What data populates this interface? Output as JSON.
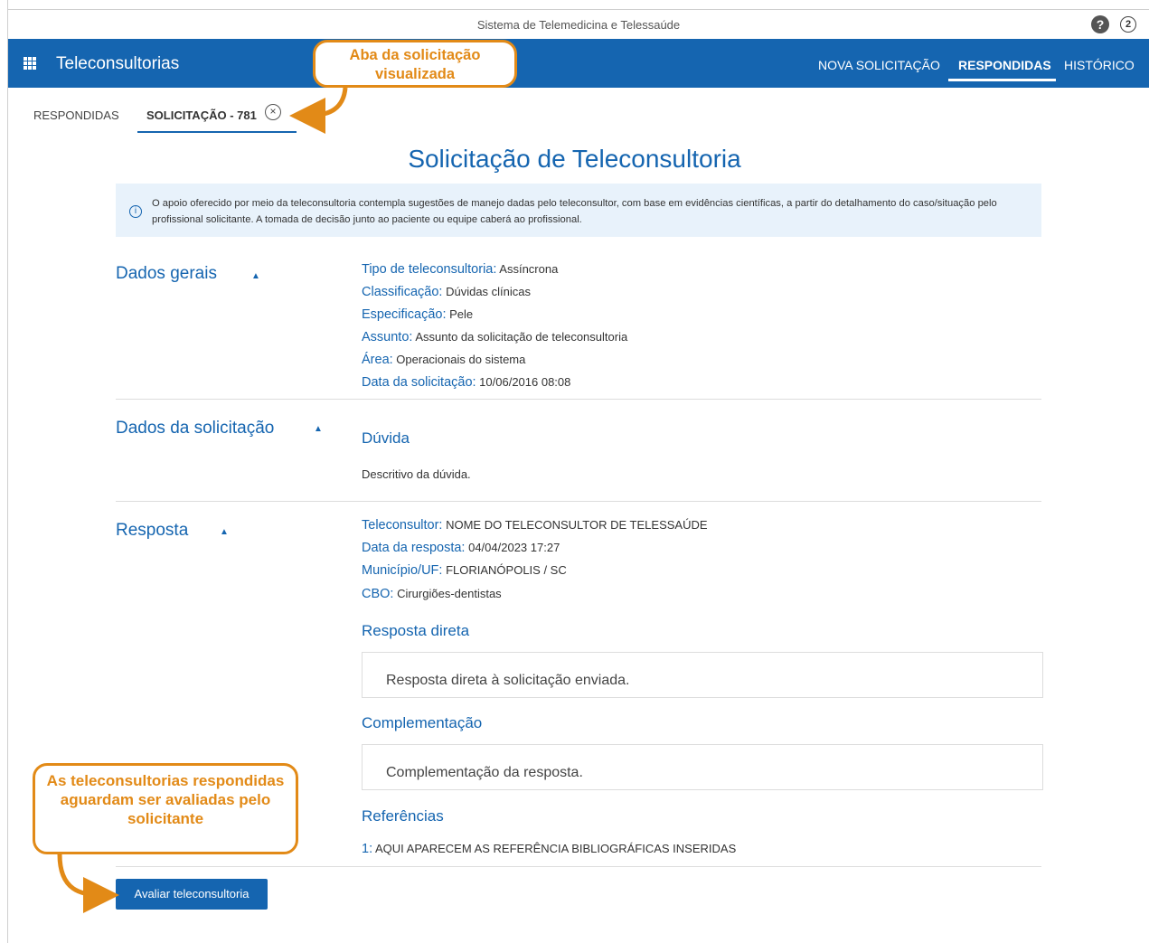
{
  "window": {
    "title": "Sistema de Telemedicina e Telessaúde",
    "help_icon": "question-circle-icon",
    "help_glyph": "?",
    "counter": "2"
  },
  "appbar": {
    "icon": "apps-grid-icon",
    "title": "Teleconsultorias",
    "color": "#1565b0",
    "nav": [
      "NOVA SOLICITAÇÃO",
      "RESPONDIDAS",
      "HISTÓRICO"
    ],
    "active": "RESPONDIDAS"
  },
  "tabs": {
    "items": [
      "RESPONDIDAS",
      "SOLICITAÇÃO - 781"
    ],
    "active": "SOLICITAÇÃO - 781",
    "close_glyph": "×"
  },
  "page": {
    "title": "Solicitação de Teleconsultoria",
    "info_glyph": "i",
    "info": "O apoio oferecido por meio da teleconsultoria contempla sugestões de manejo dadas pelo teleconsultor, com base em evidências científicas, a partir do detalhamento do caso/situação pelo profissional solicitante. A tomada de decisão junto ao paciente ou equipe caberá ao profissional."
  },
  "dados_gerais": {
    "heading": "Dados gerais",
    "fields": [
      {
        "label": "Tipo de teleconsultoria:",
        "value": "Assíncrona"
      },
      {
        "label": "Classificação:",
        "value": "Dúvidas clínicas"
      },
      {
        "label": "Especificação:",
        "value": "Pele"
      },
      {
        "label": "Assunto:",
        "value": "Assunto da solicitação de teleconsultoria"
      },
      {
        "label": "Área:",
        "value": "Operacionais do sistema"
      },
      {
        "label": "Data da solicitação:",
        "value": "10/06/2016 08:08"
      }
    ]
  },
  "dados_solicitacao": {
    "heading": "Dados da solicitação",
    "duvida_title": "Dúvida",
    "duvida_text": "Descritivo da dúvida."
  },
  "resposta": {
    "heading": "Resposta",
    "fields": [
      {
        "label": "Teleconsultor:",
        "value": "NOME DO TELECONSULTOR DE TELESSAÚDE"
      },
      {
        "label": "Data da resposta:",
        "value": "04/04/2023 17:27"
      },
      {
        "label": "Município/UF:",
        "value": "FLORIANÓPOLIS / SC"
      },
      {
        "label": "CBO:",
        "value": "Cirurgiões-dentistas"
      }
    ],
    "direta_title": "Resposta direta",
    "direta_text": "Resposta direta à solicitação enviada.",
    "complementacao_title": "Complementação",
    "complementacao_text": "Complementação da resposta.",
    "referencias_title": "Referências",
    "referencia_num": "1:",
    "referencia_text": "AQUI APARECEM AS REFERÊNCIA BIBLIOGRÁFICAS INSERIDAS"
  },
  "actions": {
    "avaliar": "Avaliar teleconsultoria"
  },
  "callouts": {
    "tab": "Aba da solicitação visualizada",
    "avaliar": "As teleconsultorias respondidas aguardam ser avaliadas pelo solicitante",
    "color": "#e28a17"
  }
}
